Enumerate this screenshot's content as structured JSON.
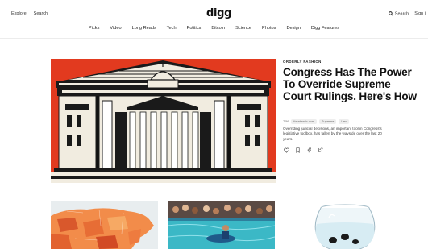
{
  "header": {
    "left_links": [
      "Explore",
      "Search"
    ],
    "logo": "digg",
    "search_label": "Search",
    "signin_label": "Sign i"
  },
  "nav": {
    "categories": [
      "Picks",
      "Video",
      "Long Reads",
      "Tech",
      "Politics",
      "Bitcoin",
      "Science",
      "Photos",
      "Design",
      "Digg Features"
    ]
  },
  "featured": {
    "kicker": "ORDERLY FASHION",
    "headline": "Congress Has The Power To Override Supreme Court Rulings. Here's How",
    "tags": [
      "7:56",
      "theatlantic.com",
      "Supreme",
      "Law"
    ],
    "description": "Overriding judicial decisions, an important tool in Congress's legislative toolbox, has fallen by the wayside over the last 20 years.",
    "accent_color": "#e23a1f"
  },
  "actions": [
    "heart-icon",
    "bookmark-icon",
    "facebook-icon",
    "twitter-icon"
  ]
}
